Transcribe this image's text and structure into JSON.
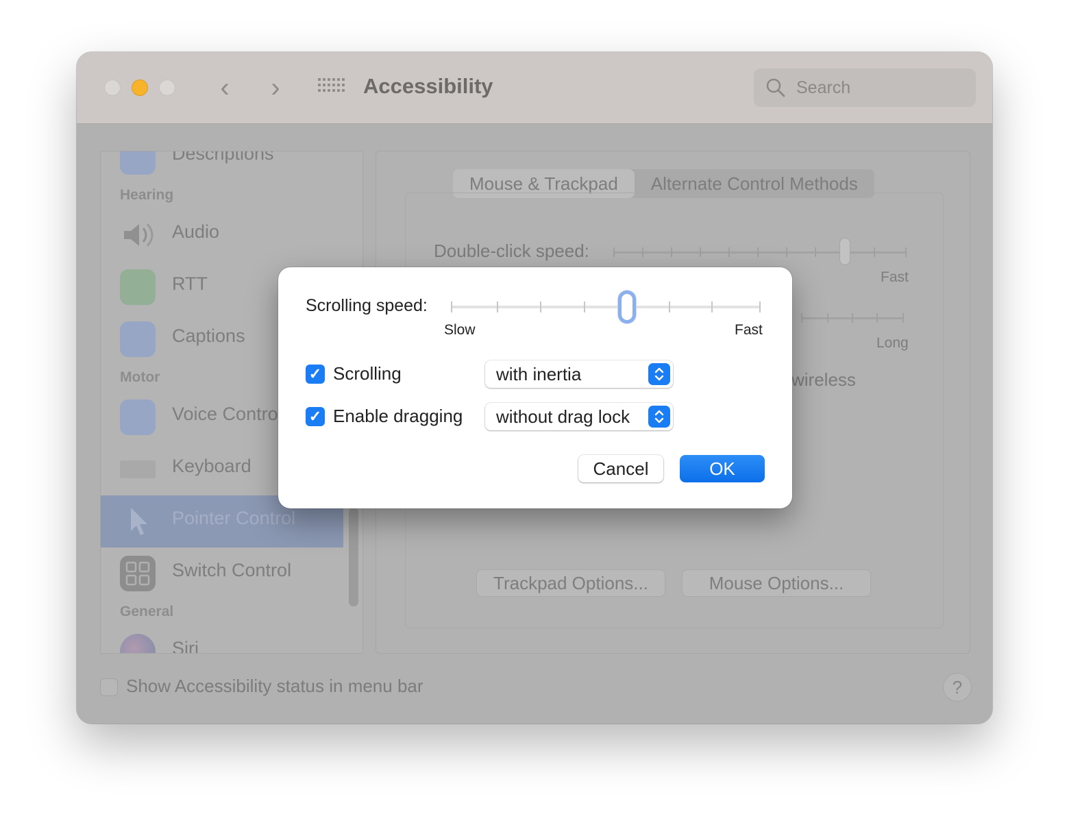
{
  "window": {
    "title": "Accessibility",
    "search_placeholder": "Search",
    "nav_back": "‹",
    "nav_forward": "›"
  },
  "sidebar": {
    "sections": {
      "hearing": "Hearing",
      "motor": "Motor",
      "general": "General"
    },
    "items": [
      {
        "label": "Descriptions",
        "icon": "descriptions-icon"
      },
      {
        "label": "Audio",
        "icon": "speaker-icon"
      },
      {
        "label": "RTT",
        "icon": "rtt-phone-icon"
      },
      {
        "label": "Captions",
        "icon": "captions-icon"
      },
      {
        "label": "Voice Control",
        "icon": "voice-control-icon"
      },
      {
        "label": "Keyboard",
        "icon": "keyboard-icon"
      },
      {
        "label": "Pointer Control",
        "icon": "pointer-icon",
        "selected": true
      },
      {
        "label": "Switch Control",
        "icon": "switch-control-icon"
      },
      {
        "label": "Siri",
        "icon": "siri-icon"
      }
    ]
  },
  "content": {
    "tabs": [
      "Mouse & Trackpad",
      "Alternate Control Methods"
    ],
    "active_tab": "Mouse & Trackpad",
    "double_click_label": "Double-click speed:",
    "double_click_max": "Fast",
    "spring_max": "Long",
    "wireless_text": "wireless",
    "trackpad_options": "Trackpad Options...",
    "mouse_options": "Mouse Options..."
  },
  "footer": {
    "status_label": "Show Accessibility status in menu bar",
    "status_checked": false,
    "help": "?"
  },
  "sheet": {
    "scrolling_speed_label": "Scrolling speed:",
    "scrolling_speed_min": "Slow",
    "scrolling_speed_max": "Fast",
    "scrolling_speed_value": 0.57,
    "scrolling_label": "Scrolling",
    "scrolling_checked": true,
    "scrolling_option": "with inertia",
    "dragging_label": "Enable dragging",
    "dragging_checked": true,
    "dragging_option": "without drag lock",
    "cancel": "Cancel",
    "ok": "OK"
  },
  "colors": {
    "accent": "#1a7df4",
    "minimize": "#f7b42a"
  }
}
